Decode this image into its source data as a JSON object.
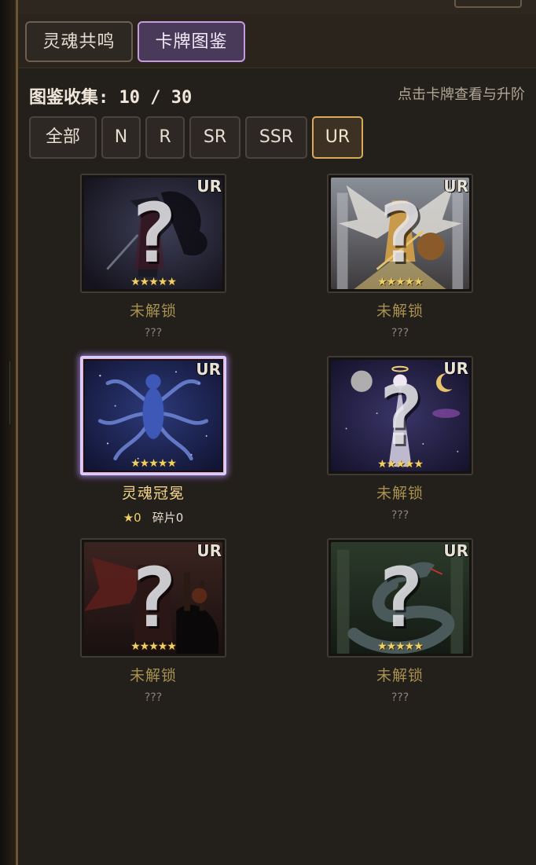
{
  "tabs": [
    {
      "label": "灵魂共鸣",
      "active": false
    },
    {
      "label": "卡牌图鉴",
      "active": true
    }
  ],
  "collection": {
    "text": "图鉴收集: 10 / 30",
    "hint": "点击卡牌查看与升阶"
  },
  "filters": [
    {
      "label": "全部",
      "active": false
    },
    {
      "label": "N",
      "active": false
    },
    {
      "label": "R",
      "active": false
    },
    {
      "label": "SR",
      "active": false
    },
    {
      "label": "SSR",
      "active": false
    },
    {
      "label": "UR",
      "active": true
    }
  ],
  "cards": [
    {
      "rarity": "UR",
      "stars": "★★★★★",
      "name": "未解锁",
      "sub": "???",
      "locked": true,
      "theme": "dark-knight"
    },
    {
      "rarity": "UR",
      "stars": "★★★★★",
      "name": "未解锁",
      "sub": "???",
      "locked": true,
      "theme": "angel"
    },
    {
      "rarity": "UR",
      "stars": "★★★★★",
      "name": "灵魂冠冕",
      "star_level": "★0",
      "shards": "碎片0",
      "locked": false,
      "theme": "cosmic-tentacles"
    },
    {
      "rarity": "UR",
      "stars": "★★★★★",
      "name": "未解锁",
      "sub": "???",
      "locked": true,
      "theme": "celestial-goddess"
    },
    {
      "rarity": "UR",
      "stars": "★★★★★",
      "name": "未解锁",
      "sub": "???",
      "locked": true,
      "theme": "demon"
    },
    {
      "rarity": "UR",
      "stars": "★★★★★",
      "name": "未解锁",
      "sub": "???",
      "locked": true,
      "theme": "serpent"
    }
  ],
  "colors": {
    "accent_tab": "#c79ae0",
    "accent_filter": "#d9a95a",
    "locked_name": "#a89250",
    "unlocked_name": "#f1d48a"
  }
}
